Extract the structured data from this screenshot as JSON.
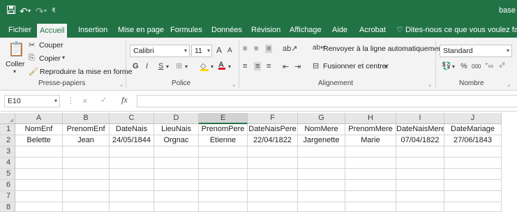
{
  "window": {
    "title": "base"
  },
  "quick_access": {
    "save_icon": "save-icon",
    "undo_icon": "undo-icon",
    "redo_icon": "redo-icon",
    "customize_icon": "customize-icon"
  },
  "tabs": [
    "Fichier",
    "Accueil",
    "Insertion",
    "Mise en page",
    "Formules",
    "Données",
    "Révision",
    "Affichage",
    "Aide",
    "Acrobat"
  ],
  "active_tab": "Accueil",
  "tell_me": "Dites-nous ce que vous voulez faire",
  "clipboard": {
    "paste": "Coller",
    "cut": "Couper",
    "copy": "Copier",
    "format_painter": "Reproduire la mise en forme",
    "group": "Presse-papiers"
  },
  "font": {
    "name": "Calibri",
    "size": "11",
    "grow": "A",
    "shrink": "A",
    "bold": "G",
    "italic": "I",
    "underline": "S",
    "group": "Police"
  },
  "alignment": {
    "wrap": "Renvoyer à la ligne automatiquement",
    "merge": "Fusionner et centrer",
    "group": "Alignement"
  },
  "number": {
    "format": "Standard",
    "percent": "%",
    "thousands": "000",
    "group": "Nombre"
  },
  "formula_bar": {
    "name_box": "E10",
    "fx": "fx",
    "cancel": "×",
    "enter": "✓",
    "value": ""
  },
  "sheet": {
    "columns": [
      "A",
      "B",
      "C",
      "D",
      "E",
      "F",
      "G",
      "H",
      "I",
      "J"
    ],
    "selected_column": "E",
    "row_numbers": [
      "1",
      "2",
      "3",
      "4",
      "5",
      "6",
      "7",
      "8"
    ],
    "rows": [
      [
        "NomEnf",
        "PrenomEnf",
        "DateNais",
        "LieuNais",
        "PrenomPere",
        "DateNaisPere",
        "NomMere",
        "PrenomMere",
        "DateNaisMere",
        "DateMariage"
      ],
      [
        "Belette",
        "Jean",
        "24/05/1844",
        "Orgnac",
        "Etienne",
        "22/04/1822",
        "Jargenette",
        "Marie",
        "07/04/1822",
        "27/06/1843"
      ],
      [
        "",
        "",
        "",
        "",
        "",
        "",
        "",
        "",
        "",
        ""
      ],
      [
        "",
        "",
        "",
        "",
        "",
        "",
        "",
        "",
        "",
        ""
      ],
      [
        "",
        "",
        "",
        "",
        "",
        "",
        "",
        "",
        "",
        ""
      ],
      [
        "",
        "",
        "",
        "",
        "",
        "",
        "",
        "",
        "",
        ""
      ],
      [
        "",
        "",
        "",
        "",
        "",
        "",
        "",
        "",
        "",
        ""
      ],
      [
        "",
        "",
        "",
        "",
        "",
        "",
        "",
        "",
        "",
        ""
      ]
    ]
  },
  "colors": {
    "brand": "#217346",
    "ribbon": "#f3f3f3",
    "header": "#e6e6e6",
    "grid": "#d4d4d4"
  }
}
